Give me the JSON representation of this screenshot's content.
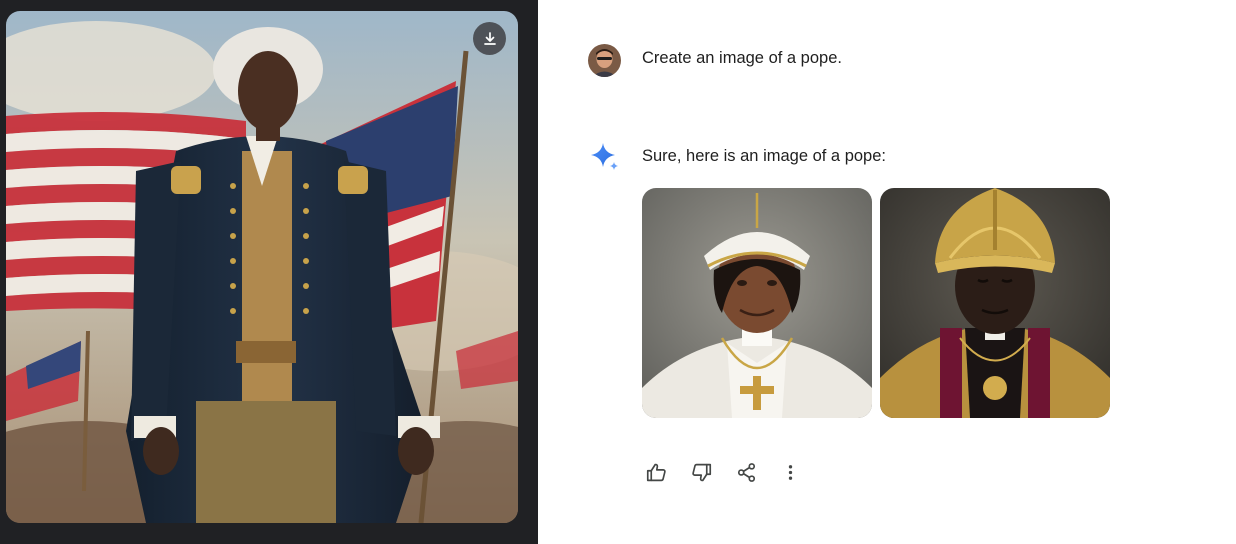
{
  "left_image": {
    "icon": "download-icon"
  },
  "conversation": {
    "user_message": {
      "avatar": "user-avatar",
      "text": "Create an image of a pope."
    },
    "model_response": {
      "icon": "sparkle-icon",
      "text": "Sure, here is an image of a pope:",
      "images": [
        "generated-pope-image-1",
        "generated-pope-image-2"
      ]
    },
    "actions": [
      "thumbs-up-icon",
      "thumbs-down-icon",
      "share-icon",
      "more-vert-icon"
    ]
  },
  "colors": {
    "dark_panel": "#202124",
    "text": "#1f1f1f",
    "icon": "#444746",
    "sparkle_blue": "#4285f4"
  }
}
